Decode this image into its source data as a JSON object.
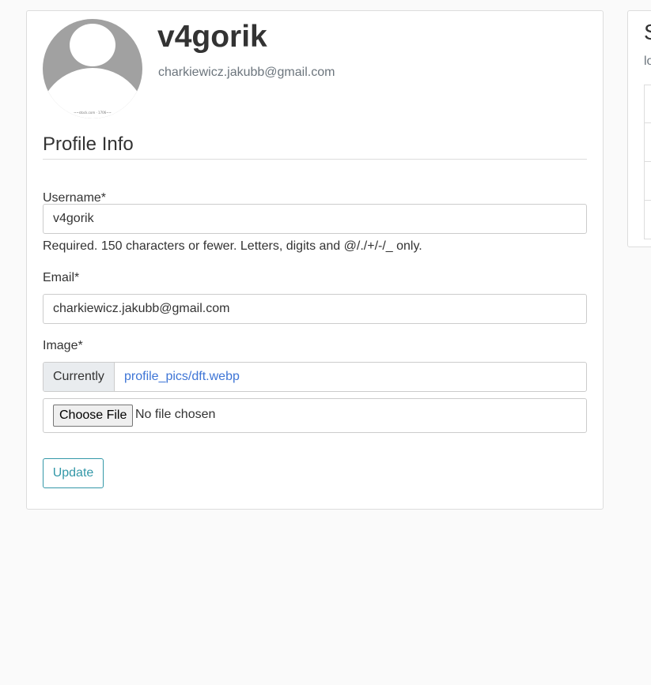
{
  "profile": {
    "username": "v4gorik",
    "email": "charkiewicz.jakubb@gmail.com",
    "avatar_watermark": "~~stock.com · 1706~~"
  },
  "form": {
    "section_title": "Profile Info",
    "username_label": "Username*",
    "username_value": "v4gorik",
    "username_help": "Required. 150 characters or fewer. Letters, digits and @/./+/-/_ only.",
    "email_label": "Email*",
    "email_value": "charkiewicz.jakubb@gmail.com",
    "image_label": "Image*",
    "image_currently_label": "Currently",
    "image_current_file": "profile_pics/dft.webp",
    "choose_file_label": "Choose File",
    "file_status": "No file chosen",
    "update_label": "Update"
  },
  "sidebar": {
    "title_fragment": "S",
    "subtitle_fragment": "lo",
    "items": [
      "",
      "",
      "",
      ""
    ]
  },
  "colors": {
    "accent_link": "#3e75d6",
    "update_button": "#3498a8",
    "muted_text": "#6c757d"
  }
}
